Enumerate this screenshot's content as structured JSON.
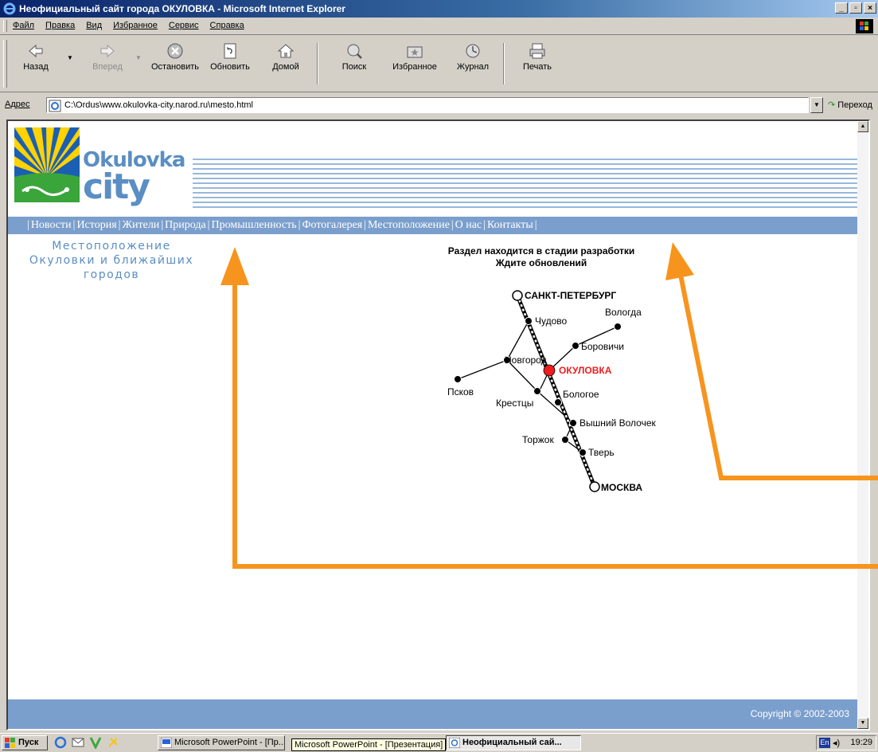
{
  "window": {
    "title": "Неофициальный сайт города ОКУЛОВКА - Microsoft Internet Explorer",
    "buttons": [
      "_",
      "▫",
      "×"
    ]
  },
  "menu": [
    "Файл",
    "Правка",
    "Вид",
    "Избранное",
    "Сервис",
    "Справка"
  ],
  "toolbar": {
    "back": "Назад",
    "forward": "Вперед",
    "stop": "Остановить",
    "refresh": "Обновить",
    "home": "Домой",
    "search": "Поиск",
    "favorites": "Избранное",
    "history": "Журнал",
    "print": "Печать"
  },
  "address": {
    "label": "Адрес",
    "url": "C:\\Ordus\\www.okulovka-city.narod.ru\\mesto.html",
    "go": "Переход"
  },
  "site": {
    "logo_word1": "Okulovka",
    "logo_word2": "city",
    "nav": [
      "Новости",
      "История",
      "Жители",
      "Природа",
      "Промышленность",
      "Фотогалерея",
      "Местоположение",
      "О нас",
      "Контакты"
    ],
    "left_heading": [
      "Местоположение",
      "Окуловки и ближайших",
      "городов"
    ],
    "notice": [
      "Раздел находится в стадии разработки",
      "Ждите обновлений"
    ],
    "copyright": "Copyright © 2002-2003"
  },
  "map": {
    "cities": {
      "spb": "САНКТ-ПЕТЕРБУРГ",
      "chudovo": "Чудово",
      "vologda": "Вологда",
      "borovichi": "Боровичи",
      "novgorod": "Новгород",
      "okulovka": "ОКУЛОВКА",
      "pskov": "Псков",
      "bologoe": "Бологое",
      "kresttsy": "Крестцы",
      "volochek": "Вышний Волочек",
      "torzhok": "Торжок",
      "tver": "Тверь",
      "moskva": "МОСКВА"
    },
    "highlight_color": "#ee1c1c"
  },
  "taskbar": {
    "start": "Пуск",
    "tasks": [
      "Microsoft PowerPoint - [Пр...",
      "Неофициальный сай..."
    ],
    "tooltip": "Microsoft PowerPoint - [Презентация]",
    "lang": "En",
    "clock": "19:29"
  },
  "colors": {
    "nav_band": "#7b9fcd",
    "logo_blue": "#5a8ec4",
    "annotation_arrow": "#f7941d"
  }
}
